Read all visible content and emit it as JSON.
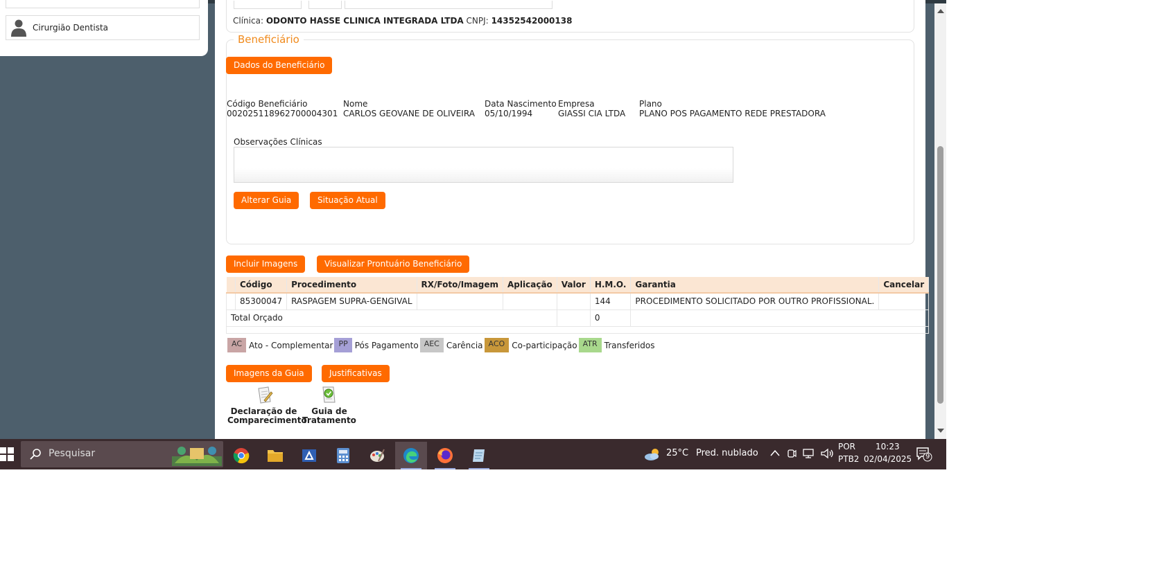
{
  "sidebar": {
    "role_label": "Cirurgião Dentista"
  },
  "clinic": {
    "label": "Clínica:",
    "name": "ODONTO HASSE CLINICA INTEGRADA LTDA",
    "cnpj_label": "CNPJ:",
    "cnpj": "14352542000138"
  },
  "beneficiary": {
    "section_title": "Beneficiário",
    "data_button": "Dados do Beneficiário",
    "fields": {
      "code_label": "Código Beneficiário",
      "code": "00202511896270000430​1",
      "name_label": "Nome",
      "name": "CARLOS GEOVANE DE OLIVEIRA",
      "birth_label": "Data Nascimento",
      "birth": "05/10/1994",
      "company_label": "Empresa",
      "company": "GIASSI CIA LTDA",
      "plan_label": "Plano",
      "plan": "PLANO POS PAGAMENTO REDE PRESTADORA"
    },
    "obs_label": "Observações Clínicas",
    "obs_value": "",
    "alter_button": "Alterar Guia",
    "status_button": "Situação Atual"
  },
  "actions": {
    "include_images": "Incluir Imagens",
    "view_record": "Visualizar Prontuário Beneficiário",
    "guide_images": "Imagens da Guia",
    "justifications": "Justificativas"
  },
  "table": {
    "headers": [
      "",
      "Código",
      "Procedimento",
      "RX/Foto/Imagem",
      "Aplicação",
      "Valor",
      "H.M.O.",
      "Garantia",
      "Cancelar"
    ],
    "rows": [
      [
        "",
        "85300047",
        "RASPAGEM SUPRA-GENGIVAL",
        "",
        "",
        "",
        "144",
        "PROCEDIMENTO SOLICITADO POR OUTRO PROFISSIONAL.",
        ""
      ]
    ],
    "total_label": "Total Orçado",
    "total_value": "0"
  },
  "legend": [
    {
      "code": "AC",
      "label": "Ato - Complementar",
      "color": "#c9a5a5"
    },
    {
      "code": "PP",
      "label": "Pós Pagamento",
      "color": "#a59fd6"
    },
    {
      "code": "AEC",
      "label": "Carência",
      "color": "#c7c7c7"
    },
    {
      "code": "ACO",
      "label": "Co-participação",
      "color": "#c8973a"
    },
    {
      "code": "ATR",
      "label": "Transferidos",
      "color": "#a8d88c"
    }
  ],
  "documents": {
    "attendance_line1": "Declaração de",
    "attendance_line2": "Comparecimento",
    "treatment_line1": "Guia de",
    "treatment_line2": "Tratamento"
  },
  "taskbar": {
    "search_placeholder": "Pesquisar",
    "weather_temp": "25°C",
    "weather_desc": "Pred. nublado",
    "lang_line1": "POR",
    "lang_line2": "PTB2",
    "time": "10:23",
    "date": "02/04/2025",
    "notifications": "9"
  },
  "colors": {
    "accent": "#ff6a00",
    "legend_title": "#f08a1c",
    "table_header": "#fbe6d3"
  }
}
